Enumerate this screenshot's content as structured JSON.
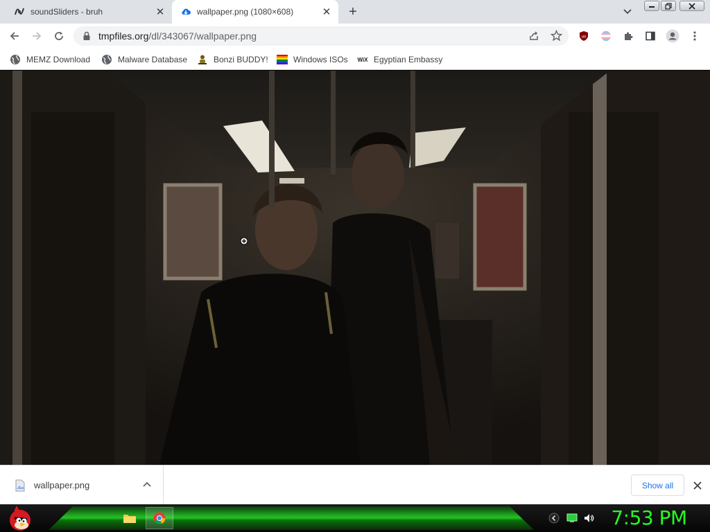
{
  "browser": {
    "tabs": [
      {
        "title": "soundSliders - bruh",
        "icon": "soundsliders-icon",
        "active": false
      },
      {
        "title": "wallpaper.png (1080×608)",
        "icon": "cloud-icon",
        "active": true
      }
    ],
    "address": {
      "host": "tmpfiles.org",
      "path": "/dl/343067/wallpaper.png"
    },
    "bookmarks": [
      {
        "label": "MEMZ Download",
        "icon": "globe-icon"
      },
      {
        "label": "Malware Database",
        "icon": "globe-icon"
      },
      {
        "label": "Bonzi BUDDY!",
        "icon": "bonzi-icon"
      },
      {
        "label": "Windows ISOs",
        "icon": "rainbow-flag-icon"
      },
      {
        "label": "Egyptian Embassy",
        "icon": "wix-icon"
      }
    ]
  },
  "viewer": {
    "image_alt": "",
    "image_size": "1080×608"
  },
  "downloads": {
    "filename": "wallpaper.png",
    "show_all": "Show all"
  },
  "taskbar": {
    "clock": "7:53 PM",
    "accent": "#22ff22"
  }
}
